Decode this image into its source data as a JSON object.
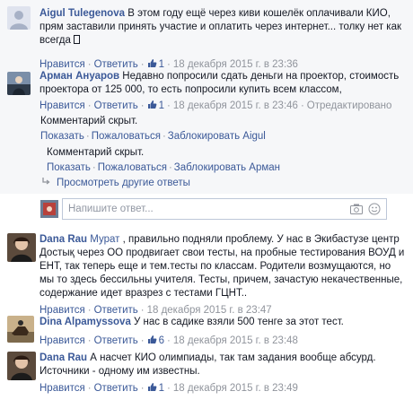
{
  "comments_top": [
    {
      "author": "Aigul Tulegenova",
      "text": "В этом году ещё через киви кошелёк оплачивали КИО, прям заставили принять участие и оплатить через интернет... толку нет как всегда",
      "like_label": "Нравится",
      "reply_label": "Ответить",
      "like_count": "1",
      "timestamp": "18 декабря 2015 г. в 23:36"
    },
    {
      "author": "Арман Ануаров",
      "text": "Недавно попросили сдать деньги на проектор, стоимость проектора от 125 000, то есть попросили купить всем классом,",
      "like_label": "Нравится",
      "reply_label": "Ответить",
      "like_count": "1",
      "timestamp": "18 декабря 2015 г. в 23:46",
      "edited_label": "Отредактировано"
    }
  ],
  "hidden_comments": [
    {
      "text": "Комментарий скрыт.",
      "show_label": "Показать",
      "report_label": "Пожаловаться",
      "block_label": "Заблокировать Aigul"
    },
    {
      "text": "Комментарий скрыт.",
      "show_label": "Показать",
      "report_label": "Пожаловаться",
      "block_label": "Заблокировать Арман"
    }
  ],
  "more_replies_label": "Просмотреть другие ответы",
  "reply_input": {
    "placeholder": "Напишите ответ..."
  },
  "comments_bottom": [
    {
      "author": "Dana Rau",
      "mention": "Мурат",
      "text": ", правильно подняли проблему. У нас в Экибастузе центр Достық через ОО продвигает свои тесты, на пробные тестирования ВОУД и ЕНТ, так теперь еще и тем.тесты по классам. Родители возмущаются, но мы то здесь бессильны учителя. Тесты, причем, зачастую некачественные, содержание идет вразрез с тестами ГЦНТ..",
      "like_label": "Нравится",
      "reply_label": "Ответить",
      "timestamp": "18 декабря 2015 г. в 23:47"
    },
    {
      "author": "Dina Alpamyssova",
      "text": "У нас в садике взяли 500 тенге за этот тест.",
      "like_label": "Нравится",
      "reply_label": "Ответить",
      "like_count": "6",
      "timestamp": "18 декабря 2015 г. в 23:48"
    },
    {
      "author": "Dana Rau",
      "text": "А насчет КИО олимпиады, так там задания вообще абсурд. Источники - одному им известны.",
      "like_label": "Нравится",
      "reply_label": "Ответить",
      "like_count": "1",
      "timestamp": "18 декабря 2015 г. в 23:49"
    }
  ],
  "colors": {
    "link": "#3b5998",
    "meta": "#90949c",
    "reply_background": "#f6f7f9"
  }
}
